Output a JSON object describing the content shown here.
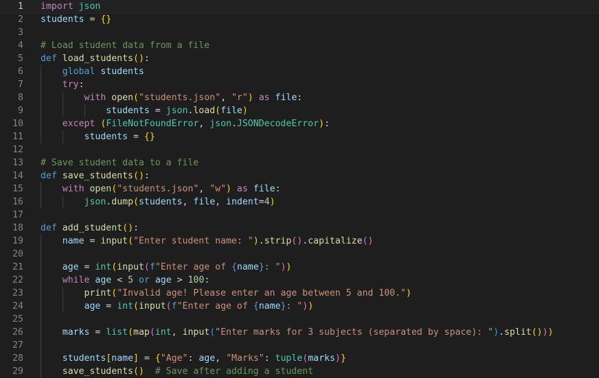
{
  "editor": {
    "language": "python",
    "active_line": 1,
    "lines": [
      {
        "n": "1",
        "indent": 0,
        "tokens": [
          [
            "ctl",
            "import"
          ],
          [
            "op",
            " "
          ],
          [
            "cls",
            "json"
          ]
        ]
      },
      {
        "n": "2",
        "indent": 0,
        "tokens": [
          [
            "var",
            "students"
          ],
          [
            "op",
            " = "
          ],
          [
            "b1",
            "{}"
          ]
        ]
      },
      {
        "n": "3",
        "indent": 0,
        "tokens": []
      },
      {
        "n": "4",
        "indent": 0,
        "tokens": [
          [
            "cmt",
            "# Load student data from a file"
          ]
        ]
      },
      {
        "n": "5",
        "indent": 0,
        "tokens": [
          [
            "kw",
            "def"
          ],
          [
            "op",
            " "
          ],
          [
            "fn",
            "load_students"
          ],
          [
            "b1",
            "()"
          ],
          [
            "op",
            ":"
          ]
        ]
      },
      {
        "n": "6",
        "indent": 1,
        "tokens": [
          [
            "kw",
            "global"
          ],
          [
            "op",
            " "
          ],
          [
            "var",
            "students"
          ]
        ]
      },
      {
        "n": "7",
        "indent": 1,
        "tokens": [
          [
            "ctl",
            "try"
          ],
          [
            "op",
            ":"
          ]
        ]
      },
      {
        "n": "8",
        "indent": 2,
        "tokens": [
          [
            "ctl",
            "with"
          ],
          [
            "op",
            " "
          ],
          [
            "fn",
            "open"
          ],
          [
            "b1",
            "("
          ],
          [
            "str",
            "\"students.json\""
          ],
          [
            "op",
            ", "
          ],
          [
            "str",
            "\"r\""
          ],
          [
            "b1",
            ")"
          ],
          [
            "op",
            " "
          ],
          [
            "ctl",
            "as"
          ],
          [
            "op",
            " "
          ],
          [
            "var",
            "file"
          ],
          [
            "op",
            ":"
          ]
        ]
      },
      {
        "n": "9",
        "indent": 3,
        "tokens": [
          [
            "var",
            "students"
          ],
          [
            "op",
            " = "
          ],
          [
            "cls",
            "json"
          ],
          [
            "op",
            "."
          ],
          [
            "fn",
            "load"
          ],
          [
            "b1",
            "("
          ],
          [
            "var",
            "file"
          ],
          [
            "b1",
            ")"
          ]
        ]
      },
      {
        "n": "10",
        "indent": 1,
        "tokens": [
          [
            "ctl",
            "except"
          ],
          [
            "op",
            " "
          ],
          [
            "b1",
            "("
          ],
          [
            "cls",
            "FileNotFoundError"
          ],
          [
            "op",
            ", "
          ],
          [
            "cls",
            "json"
          ],
          [
            "op",
            "."
          ],
          [
            "cls",
            "JSONDecodeError"
          ],
          [
            "b1",
            ")"
          ],
          [
            "op",
            ":"
          ]
        ]
      },
      {
        "n": "11",
        "indent": 2,
        "tokens": [
          [
            "var",
            "students"
          ],
          [
            "op",
            " = "
          ],
          [
            "b1",
            "{}"
          ]
        ]
      },
      {
        "n": "12",
        "indent": 0,
        "tokens": []
      },
      {
        "n": "13",
        "indent": 0,
        "tokens": [
          [
            "cmt",
            "# Save student data to a file"
          ]
        ]
      },
      {
        "n": "14",
        "indent": 0,
        "tokens": [
          [
            "kw",
            "def"
          ],
          [
            "op",
            " "
          ],
          [
            "fn",
            "save_students"
          ],
          [
            "b1",
            "()"
          ],
          [
            "op",
            ":"
          ]
        ]
      },
      {
        "n": "15",
        "indent": 1,
        "tokens": [
          [
            "ctl",
            "with"
          ],
          [
            "op",
            " "
          ],
          [
            "fn",
            "open"
          ],
          [
            "b1",
            "("
          ],
          [
            "str",
            "\"students.json\""
          ],
          [
            "op",
            ", "
          ],
          [
            "str",
            "\"w\""
          ],
          [
            "b1",
            ")"
          ],
          [
            "op",
            " "
          ],
          [
            "ctl",
            "as"
          ],
          [
            "op",
            " "
          ],
          [
            "var",
            "file"
          ],
          [
            "op",
            ":"
          ]
        ]
      },
      {
        "n": "16",
        "indent": 2,
        "tokens": [
          [
            "cls",
            "json"
          ],
          [
            "op",
            "."
          ],
          [
            "fn",
            "dump"
          ],
          [
            "b1",
            "("
          ],
          [
            "var",
            "students"
          ],
          [
            "op",
            ", "
          ],
          [
            "var",
            "file"
          ],
          [
            "op",
            ", "
          ],
          [
            "var",
            "indent"
          ],
          [
            "op",
            "="
          ],
          [
            "num",
            "4"
          ],
          [
            "b1",
            ")"
          ]
        ]
      },
      {
        "n": "17",
        "indent": 0,
        "tokens": []
      },
      {
        "n": "18",
        "indent": 0,
        "tokens": [
          [
            "kw",
            "def"
          ],
          [
            "op",
            " "
          ],
          [
            "fn",
            "add_student"
          ],
          [
            "b1",
            "()"
          ],
          [
            "op",
            ":"
          ]
        ]
      },
      {
        "n": "19",
        "indent": 1,
        "tokens": [
          [
            "var",
            "name"
          ],
          [
            "op",
            " = "
          ],
          [
            "fn",
            "input"
          ],
          [
            "b1",
            "("
          ],
          [
            "str",
            "\"Enter student name: \""
          ],
          [
            "b1",
            ")"
          ],
          [
            "op",
            "."
          ],
          [
            "fn",
            "strip"
          ],
          [
            "b2",
            "()"
          ],
          [
            "op",
            "."
          ],
          [
            "fn",
            "capitalize"
          ],
          [
            "b2",
            "()"
          ]
        ]
      },
      {
        "n": "20",
        "indent": 0,
        "tokens": []
      },
      {
        "n": "21",
        "indent": 1,
        "tokens": [
          [
            "var",
            "age"
          ],
          [
            "op",
            " = "
          ],
          [
            "cls",
            "int"
          ],
          [
            "b1",
            "("
          ],
          [
            "fn",
            "input"
          ],
          [
            "b2",
            "("
          ],
          [
            "kw",
            "f"
          ],
          [
            "str",
            "\"Enter age of "
          ],
          [
            "kw",
            "{"
          ],
          [
            "var",
            "name"
          ],
          [
            "kw",
            "}"
          ],
          [
            "str",
            ": \""
          ],
          [
            "b2",
            ")"
          ],
          [
            "b1",
            ")"
          ]
        ]
      },
      {
        "n": "22",
        "indent": 1,
        "tokens": [
          [
            "ctl",
            "while"
          ],
          [
            "op",
            " "
          ],
          [
            "var",
            "age"
          ],
          [
            "op",
            " < "
          ],
          [
            "num",
            "5"
          ],
          [
            "op",
            " "
          ],
          [
            "kw",
            "or"
          ],
          [
            "op",
            " "
          ],
          [
            "var",
            "age"
          ],
          [
            "op",
            " > "
          ],
          [
            "num",
            "100"
          ],
          [
            "op",
            ":"
          ]
        ]
      },
      {
        "n": "23",
        "indent": 2,
        "tokens": [
          [
            "fn",
            "print"
          ],
          [
            "b1",
            "("
          ],
          [
            "str",
            "\"Invalid age! Please enter an age between 5 and 100.\""
          ],
          [
            "b1",
            ")"
          ]
        ]
      },
      {
        "n": "24",
        "indent": 2,
        "tokens": [
          [
            "var",
            "age"
          ],
          [
            "op",
            " = "
          ],
          [
            "cls",
            "int"
          ],
          [
            "b1",
            "("
          ],
          [
            "fn",
            "input"
          ],
          [
            "b2",
            "("
          ],
          [
            "kw",
            "f"
          ],
          [
            "str",
            "\"Enter age of "
          ],
          [
            "kw",
            "{"
          ],
          [
            "var",
            "name"
          ],
          [
            "kw",
            "}"
          ],
          [
            "str",
            ": \""
          ],
          [
            "b2",
            ")"
          ],
          [
            "b1",
            ")"
          ]
        ]
      },
      {
        "n": "25",
        "indent": 0,
        "tokens": []
      },
      {
        "n": "26",
        "indent": 1,
        "tokens": [
          [
            "var",
            "marks"
          ],
          [
            "op",
            " = "
          ],
          [
            "cls",
            "list"
          ],
          [
            "b1",
            "("
          ],
          [
            "fn",
            "map"
          ],
          [
            "b2",
            "("
          ],
          [
            "cls",
            "int"
          ],
          [
            "op",
            ", "
          ],
          [
            "fn",
            "input"
          ],
          [
            "b3",
            "("
          ],
          [
            "str",
            "\"Enter marks for 3 subjects (separated by space): \""
          ],
          [
            "b3",
            ")"
          ],
          [
            "op",
            "."
          ],
          [
            "fn",
            "split"
          ],
          [
            "b1",
            "()"
          ],
          [
            "b2",
            ")"
          ],
          [
            "b1",
            ")"
          ]
        ]
      },
      {
        "n": "27",
        "indent": 0,
        "tokens": []
      },
      {
        "n": "28",
        "indent": 1,
        "tokens": [
          [
            "var",
            "students"
          ],
          [
            "b1",
            "["
          ],
          [
            "var",
            "name"
          ],
          [
            "b1",
            "]"
          ],
          [
            "op",
            " = "
          ],
          [
            "b1",
            "{"
          ],
          [
            "str",
            "\"Age\""
          ],
          [
            "op",
            ": "
          ],
          [
            "var",
            "age"
          ],
          [
            "op",
            ", "
          ],
          [
            "str",
            "\"Marks\""
          ],
          [
            "op",
            ": "
          ],
          [
            "cls",
            "tuple"
          ],
          [
            "b2",
            "("
          ],
          [
            "var",
            "marks"
          ],
          [
            "b2",
            ")"
          ],
          [
            "b1",
            "}"
          ]
        ]
      },
      {
        "n": "29",
        "indent": 1,
        "tokens": [
          [
            "fn",
            "save_students"
          ],
          [
            "b1",
            "()"
          ],
          [
            "op",
            "  "
          ],
          [
            "cmt",
            "# Save after adding a student"
          ]
        ]
      }
    ]
  }
}
